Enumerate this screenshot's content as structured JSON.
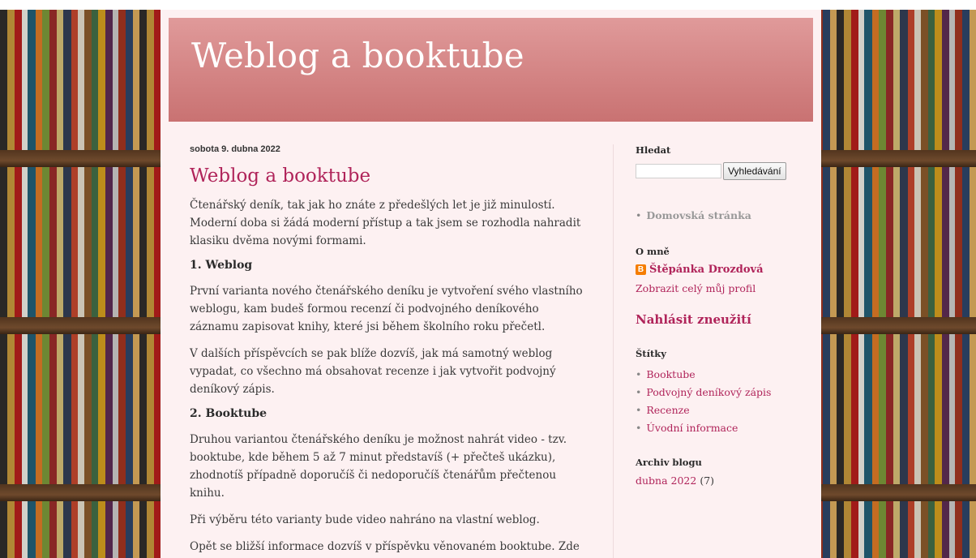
{
  "header": {
    "title": "Weblog a booktube"
  },
  "post": {
    "date": "sobota 9. dubna 2022",
    "title": "Weblog a booktube",
    "paragraphs": [
      "Čtenářský deník, tak jak ho znáte z předešlých let je již minulostí. Moderní doba si žádá moderní přístup a tak jsem se rozhodla nahradit klasiku dvěma novými formami.",
      "1. Weblog",
      "První varianta nového čtenářského deníku je vytvoření svého vlastního weblogu, kam budeš formou recenzí či podvojného deníkového záznamu zapisovat knihy, které jsi během školního roku přečetl.",
      "V dalších příspěvcích se pak blíže dozvíš, jak má samotný weblog vypadat, co všechno má obsahovat recenze i jak vytvořit podvojný deníkový zápis.",
      "2. Booktube",
      "Druhou variantou čtenářského deníku je možnost nahrát video - tzv. booktube, kde během 5 až 7 minut představíš (+ přečteš ukázku), zhodnotíš případně doporučíš či nedoporučíš čtenářům přečtenou knihu.",
      "Při výběru této varianty bude video nahráno na vlastní weblog.",
      "Opět se bližší informace dozvíš v příspěvku věnovaném booktube. Zde nalezneš i praktickou ukázku."
    ]
  },
  "sidebar": {
    "search": {
      "title": "Hledat",
      "input_value": "",
      "button_label": "Vyhledávání"
    },
    "pages": {
      "items": [
        "Domovská stránka"
      ]
    },
    "profile": {
      "title": "O mně",
      "name": "Štěpánka Drozdová",
      "link": "Zobrazit celý můj profil"
    },
    "report_abuse": "Nahlásit zneužití",
    "labels": {
      "title": "Štítky",
      "items": [
        "Booktube",
        "Podvojný deníkový zápis",
        "Recenze",
        "Úvodní informace"
      ]
    },
    "archive": {
      "title": "Archiv blogu",
      "month": "dubna 2022",
      "count": "(7)"
    }
  },
  "colors": {
    "accent": "#b0245a",
    "header_bg": "#d98585",
    "content_bg": "#fdf1f2"
  }
}
